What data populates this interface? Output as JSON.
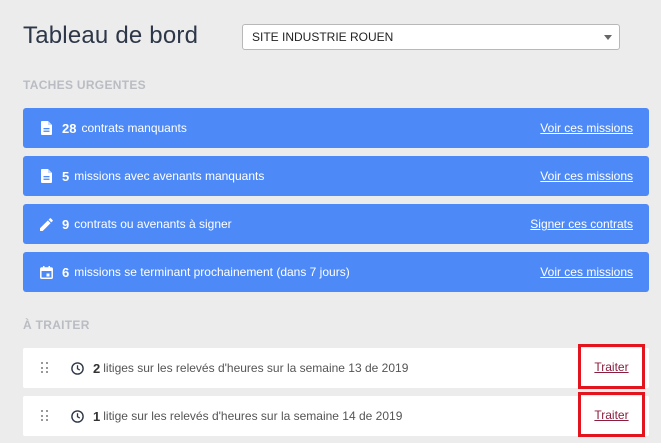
{
  "header": {
    "title": "Tableau de bord",
    "site_select": {
      "value": "SITE INDUSTRIE ROUEN"
    }
  },
  "urgent": {
    "label": "TACHES URGENTES",
    "items": [
      {
        "icon": "document-icon",
        "count": "28",
        "text": "contrats manquants",
        "link": "Voir ces missions"
      },
      {
        "icon": "document-icon",
        "count": "5",
        "text": "missions avec avenants manquants",
        "link": "Voir ces missions"
      },
      {
        "icon": "pencil-icon",
        "count": "9",
        "text": "contrats ou avenants à signer",
        "link": "Signer ces contrats"
      },
      {
        "icon": "calendar-icon",
        "count": "6",
        "text": "missions se terminant prochainement (dans 7 jours)",
        "link": "Voir ces missions"
      }
    ]
  },
  "todo": {
    "label": "À TRAITER",
    "items": [
      {
        "count": "2",
        "text": "litiges sur les relevés d'heures sur la semaine 13 de 2019",
        "action": "Traiter"
      },
      {
        "count": "1",
        "text": "litige sur les relevés d'heures sur la semaine 14 de 2019",
        "action": "Traiter"
      }
    ]
  },
  "colors": {
    "urgent_card": "#4e8af7",
    "highlight_border": "#e3141d",
    "action_link": "#8b1d3d"
  }
}
